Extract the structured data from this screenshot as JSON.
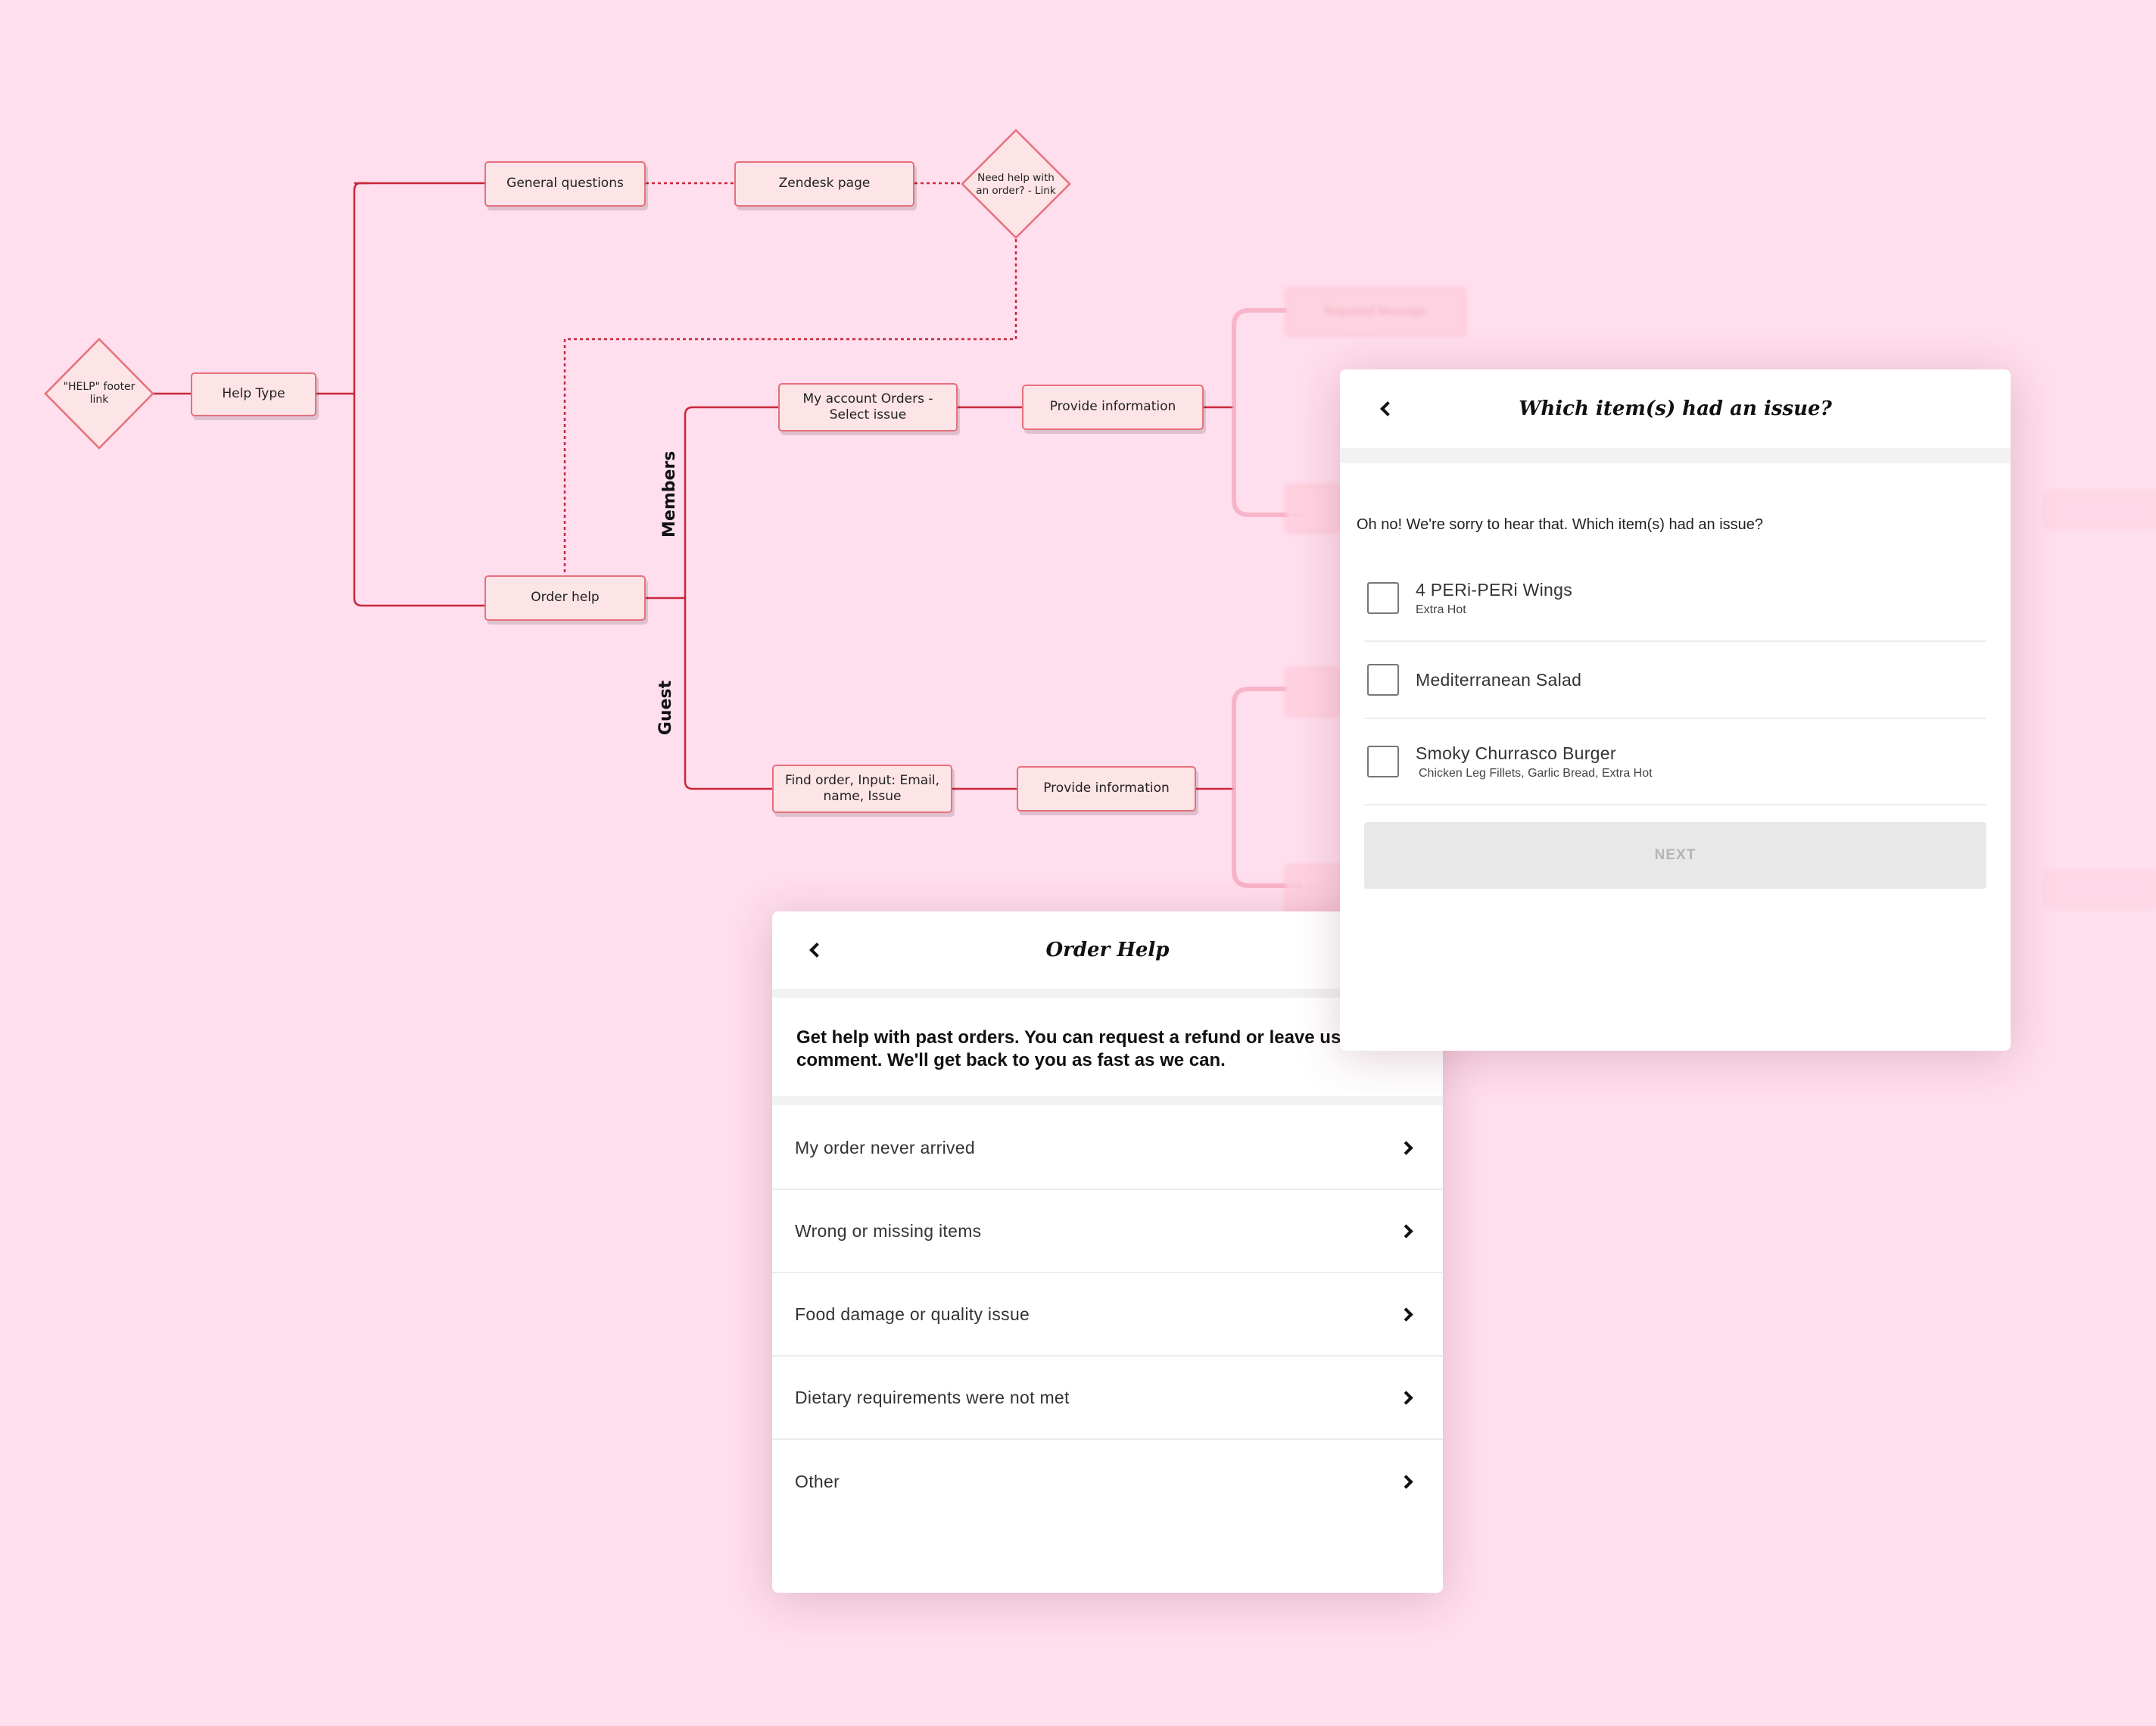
{
  "flow": {
    "help_footer_link": "\"HELP\" footer link",
    "help_type": "Help Type",
    "general_questions": "General questions",
    "zendesk_page": "Zendesk page",
    "need_help_link": "Need help with an order? - Link",
    "order_help": "Order help",
    "lane_members": "Members",
    "lane_guest": "Guest",
    "my_account": "My account Orders - Select issue",
    "find_order": "Find order, Input: Email, name, Issue",
    "provide_info_members": "Provide information",
    "provide_info_guest": "Provide information",
    "ghost_top": "Reported Message"
  },
  "colors": {
    "background": "#ffdeed",
    "node_fill": "#fde4e7",
    "node_stroke": "#e6707c",
    "connector": "#c8283c",
    "next_disabled_bg": "#e8e8e8"
  },
  "order_help_panel": {
    "title": "Order Help",
    "intro": "Get help with past orders. You can request a refund or leave us a comment. We'll get back to you as fast as we can.",
    "options": [
      {
        "label": "My order never arrived"
      },
      {
        "label": "Wrong or missing items"
      },
      {
        "label": "Food damage or quality issue"
      },
      {
        "label": "Dietary requirements were not met"
      },
      {
        "label": "Other"
      }
    ]
  },
  "items_panel": {
    "title": "Which item(s) had an issue?",
    "prompt": "Oh no! We're sorry to hear that. Which item(s) had an issue?",
    "items": [
      {
        "name": "4 PERi-PERi Wings",
        "detail": "Extra Hot",
        "checked": false
      },
      {
        "name": "Mediterranean Salad",
        "detail": "",
        "checked": false
      },
      {
        "name": "Smoky Churrasco Burger",
        "detail": "Chicken Leg Fillets, Garlic Bread, Extra Hot",
        "checked": false
      }
    ],
    "next_label": "NEXT"
  }
}
